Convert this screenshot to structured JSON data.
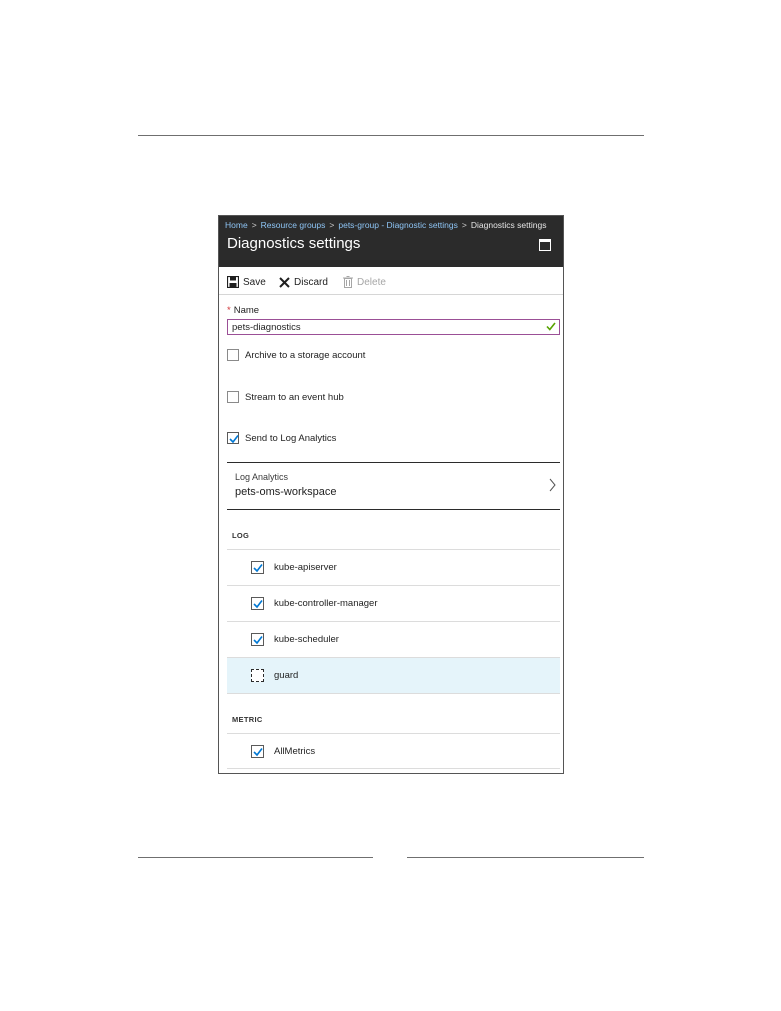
{
  "breadcrumb": [
    {
      "label": "Home"
    },
    {
      "label": "Resource groups"
    },
    {
      "label": "pets-group - Diagnostic settings"
    },
    {
      "label": "Diagnostics settings"
    }
  ],
  "blade": {
    "title": "Diagnostics settings",
    "maximize_icon": "maximize-icon"
  },
  "toolbar": {
    "save_label": "Save",
    "discard_label": "Discard",
    "delete_label": "Delete"
  },
  "form": {
    "name_label": "Name",
    "name_required_mark": "*",
    "name_value": "pets-diagnostics",
    "archive_label": "Archive to a storage account",
    "archive_checked": false,
    "stream_label": "Stream to an event hub",
    "stream_checked": false,
    "send_label": "Send to Log Analytics",
    "send_checked": true
  },
  "log_analytics": {
    "label": "Log Analytics",
    "value": "pets-oms-workspace"
  },
  "log_section": {
    "heading": "LOG",
    "items": [
      {
        "label": "kube-apiserver",
        "checked": true
      },
      {
        "label": "kube-controller-manager",
        "checked": true
      },
      {
        "label": "kube-scheduler",
        "checked": true
      },
      {
        "label": "guard",
        "checked": false,
        "focused": true
      }
    ]
  },
  "metric_section": {
    "heading": "METRIC",
    "items": [
      {
        "label": "AllMetrics",
        "checked": true
      }
    ]
  },
  "colors": {
    "header_bg": "#2b2b2b",
    "link": "#8ec5f5",
    "check": "#0078d4",
    "valid": "#57a300",
    "input_border": "#9b4f96",
    "highlight_row": "#e5f4fa"
  }
}
